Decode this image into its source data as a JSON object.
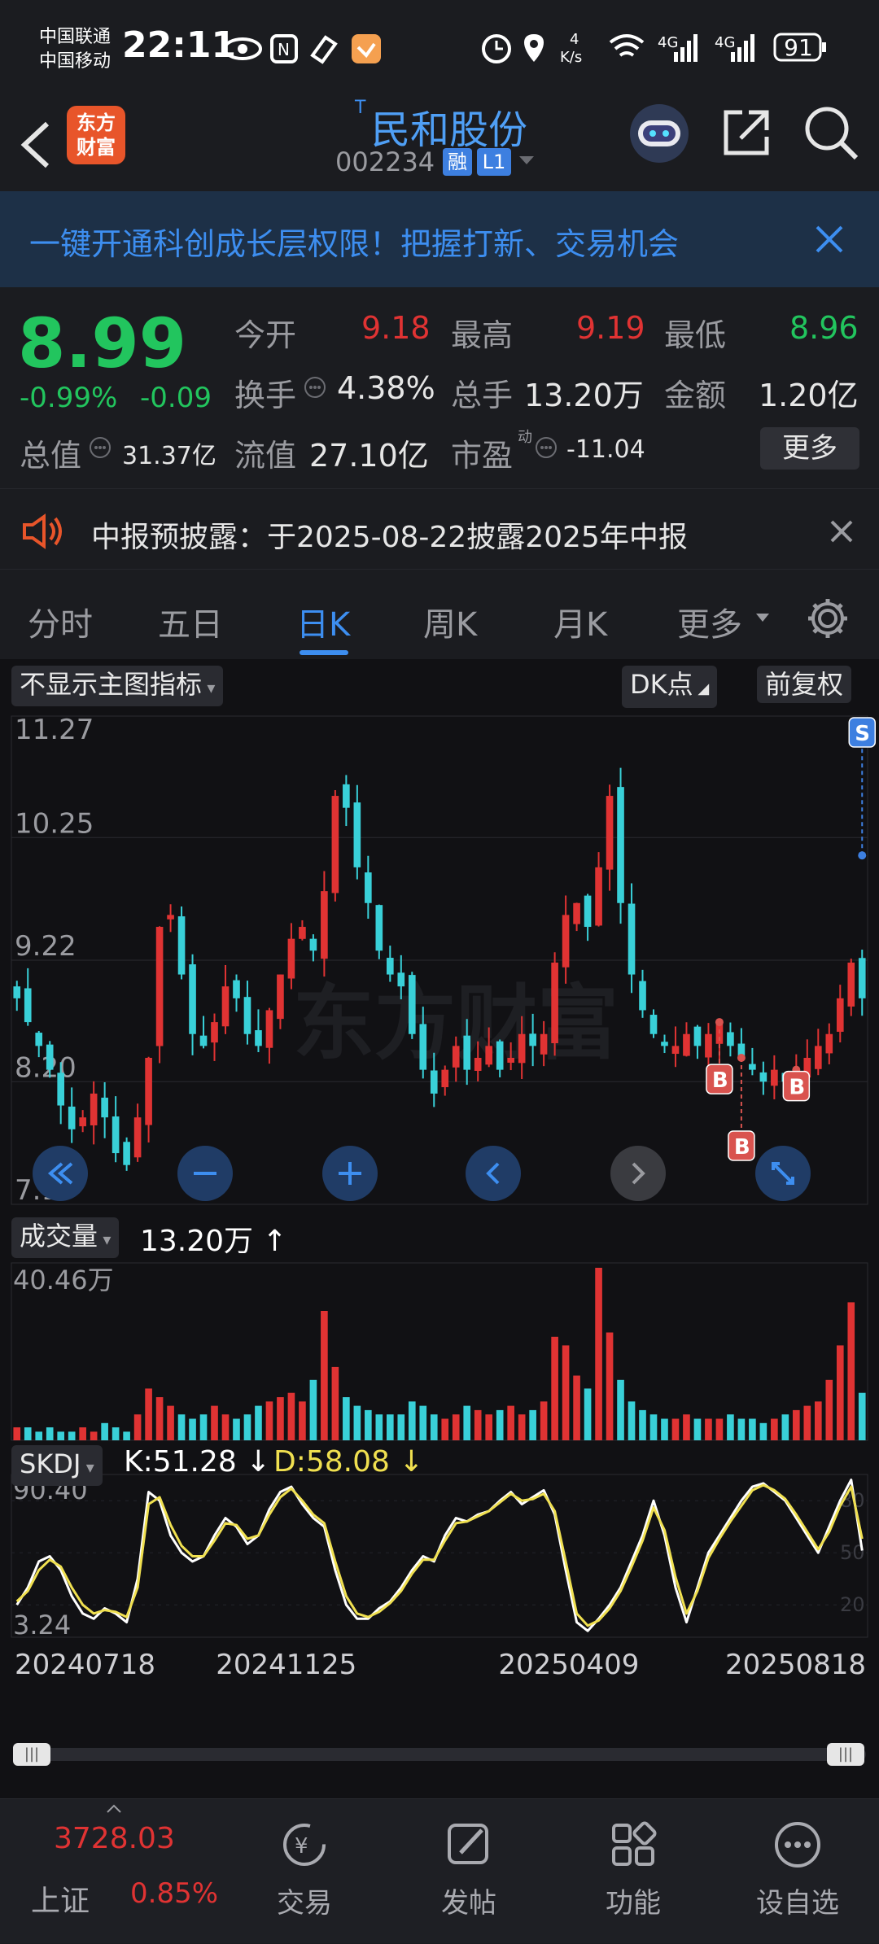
{
  "status": {
    "carrier1": "中国联通",
    "carrier2": "中国移动",
    "time": "22:11",
    "speed_top": "4",
    "speed_unit": "K/s",
    "battery": "91"
  },
  "header": {
    "app_logo_line1": "东方",
    "app_logo_line2": "财富",
    "stock_name": "民和股份",
    "stock_prefix": "T",
    "stock_code": "002234",
    "tag_rong": "融",
    "tag_level": "L1"
  },
  "banner": {
    "text": "一键开通科创成长层权限！把握打新、交易机会"
  },
  "quote": {
    "price": "8.99",
    "change_pct": "-0.99%",
    "change": "-0.09",
    "open_label": "今开",
    "open": "9.18",
    "high_label": "最高",
    "high": "9.19",
    "low_label": "最低",
    "low": "8.96",
    "turnover_label": "换手",
    "turnover": "4.38%",
    "volume_label": "总手",
    "volume": "13.20万",
    "amount_label": "金额",
    "amount": "1.20亿",
    "mktcap_label": "总值",
    "mktcap": "31.37亿",
    "float_label": "流值",
    "float": "27.10亿",
    "pe_label": "市盈",
    "pe_sup": "动",
    "pe": "-11.04",
    "more_label": "更多"
  },
  "notice": {
    "text": "中报预披露：于2025-08-22披露2025年中报"
  },
  "tabs": [
    "分时",
    "五日",
    "日K",
    "周K",
    "月K",
    "更多"
  ],
  "active_tab": "日K",
  "chart_controls": {
    "indicator_select": "不显示主图指标",
    "dk_label": "DK点",
    "adjust_label": "前复权",
    "volume_select": "成交量",
    "volume_value": "13.20万",
    "skdj_select": "SKDJ",
    "k_value": "K:51.28",
    "d_value": "D:58.08"
  },
  "colors": {
    "up": "#e03333",
    "down": "#39d0d8",
    "price_green": "#22c55e",
    "accent": "#3d8ef0",
    "k_line": "#ffffff",
    "d_line": "#f0e050"
  },
  "chart_data": [
    {
      "type": "candlestick",
      "yaxis_ticks": [
        "11.27",
        "10.25",
        "9.22",
        "8.20",
        "7.17"
      ],
      "ylim": [
        7.17,
        11.27
      ],
      "x_ticks": [
        "20240718",
        "20241125",
        "20250409",
        "20250818"
      ],
      "series": [
        {
          "name": "close",
          "values": [
            8.9,
            8.7,
            8.5,
            8.3,
            8.0,
            7.8,
            7.9,
            8.1,
            7.9,
            7.6,
            7.5,
            7.9,
            8.4,
            9.5,
            9.6,
            9.1,
            8.6,
            8.5,
            8.7,
            9.0,
            8.9,
            8.6,
            8.5,
            8.8,
            9.1,
            9.4,
            9.5,
            9.3,
            9.8,
            10.6,
            10.5,
            10.0,
            9.7,
            9.3,
            9.1,
            9.0,
            8.6,
            8.3,
            8.1,
            8.3,
            8.5,
            8.3,
            8.4,
            8.5,
            8.3,
            8.4,
            8.6,
            8.5,
            8.6,
            9.2,
            9.6,
            9.7,
            9.5,
            10.0,
            10.6,
            9.7,
            9.1,
            8.8,
            8.6,
            8.5,
            8.5,
            8.6,
            8.5,
            8.6,
            8.7,
            8.5,
            8.4,
            8.3,
            8.2,
            8.3,
            8.2,
            8.3,
            8.4,
            8.5,
            8.6,
            8.9,
            9.2,
            8.9
          ]
        }
      ],
      "annotations": [
        {
          "label": "S",
          "type": "sell"
        },
        {
          "label": "B",
          "type": "buy"
        },
        {
          "label": "B",
          "type": "buy"
        },
        {
          "label": "B",
          "type": "buy"
        }
      ]
    },
    {
      "type": "bar",
      "title": "成交量",
      "yaxis_ticks": [
        "40.46万"
      ],
      "series": [
        {
          "name": "volume",
          "values": [
            3,
            3,
            2,
            3,
            2,
            2,
            3,
            2,
            4,
            3,
            2,
            6,
            12,
            10,
            8,
            6,
            5,
            6,
            8,
            6,
            5,
            6,
            8,
            9,
            10,
            11,
            9,
            14,
            30,
            17,
            10,
            8,
            7,
            6,
            6,
            6,
            9,
            8,
            6,
            5,
            6,
            8,
            7,
            6,
            7,
            8,
            6,
            7,
            9,
            24,
            22,
            15,
            12,
            40,
            25,
            14,
            9,
            7,
            6,
            5,
            5,
            6,
            5,
            5,
            5,
            6,
            5,
            5,
            4,
            5,
            6,
            7,
            8,
            9,
            14,
            22,
            32,
            11
          ]
        }
      ]
    },
    {
      "type": "line",
      "title": "SKDJ",
      "yaxis_ticks": [
        "90.40",
        "3.24"
      ],
      "ref_levels": [
        "80",
        "50",
        "20"
      ],
      "series": [
        {
          "name": "K",
          "values": [
            20,
            30,
            45,
            48,
            40,
            25,
            15,
            12,
            18,
            15,
            10,
            35,
            85,
            80,
            60,
            50,
            45,
            48,
            60,
            70,
            65,
            55,
            60,
            75,
            85,
            88,
            78,
            70,
            65,
            40,
            20,
            12,
            12,
            18,
            22,
            30,
            40,
            48,
            45,
            60,
            70,
            68,
            72,
            74,
            80,
            85,
            78,
            82,
            86,
            72,
            40,
            10,
            5,
            12,
            20,
            30,
            45,
            60,
            80,
            60,
            30,
            10,
            30,
            50,
            60,
            70,
            80,
            88,
            90,
            85,
            80,
            70,
            60,
            50,
            65,
            80,
            92,
            51.28
          ]
        },
        {
          "name": "D",
          "values": [
            22,
            28,
            40,
            46,
            42,
            30,
            20,
            15,
            17,
            16,
            13,
            30,
            78,
            82,
            66,
            54,
            48,
            48,
            57,
            67,
            66,
            58,
            60,
            72,
            82,
            87,
            80,
            72,
            67,
            45,
            25,
            15,
            13,
            16,
            21,
            28,
            38,
            46,
            46,
            57,
            67,
            68,
            71,
            74,
            79,
            84,
            80,
            81,
            84,
            74,
            45,
            15,
            8,
            11,
            18,
            28,
            42,
            57,
            76,
            63,
            36,
            15,
            28,
            47,
            58,
            68,
            77,
            86,
            89,
            86,
            81,
            72,
            62,
            52,
            62,
            77,
            88,
            58.08
          ]
        }
      ]
    }
  ],
  "bottom_nav": {
    "index_value": "3728.03",
    "index_name": "上证",
    "index_change": "0.85%",
    "items": [
      "交易",
      "发帖",
      "功能",
      "设自选"
    ]
  }
}
